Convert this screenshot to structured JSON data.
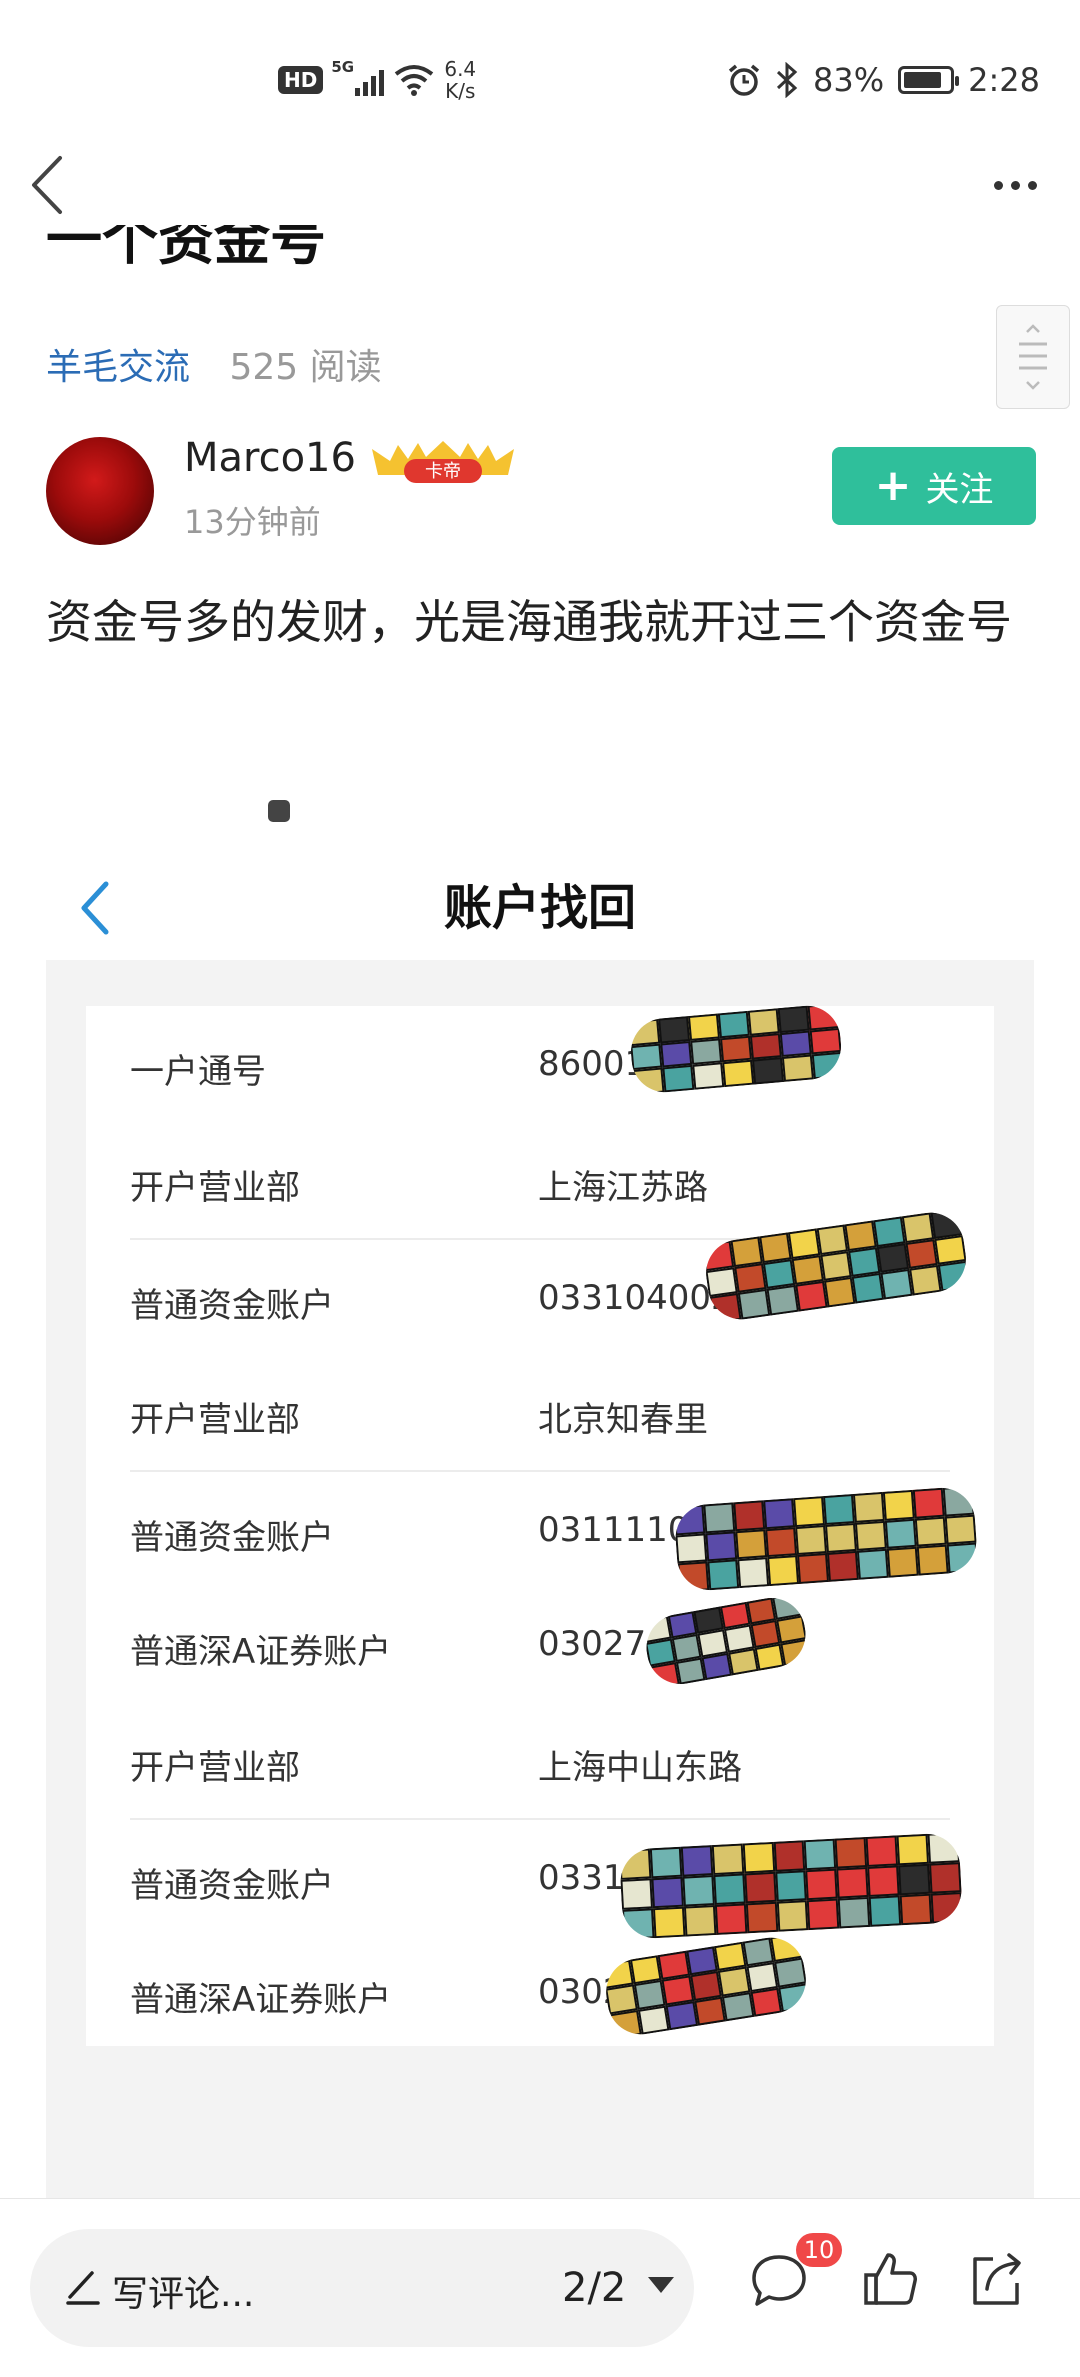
{
  "status_bar": {
    "hd": "HD",
    "net": "5G",
    "speed_value": "6.4",
    "speed_unit": "K/s",
    "battery_text": "83%",
    "battery_level": 0.83,
    "time": "2:28"
  },
  "article": {
    "title_cut": "一个资金号",
    "category": "羊毛交流",
    "reads": "525 阅读"
  },
  "author": {
    "name": "Marco16",
    "badge": "卡帝",
    "time": "13分钟前",
    "follow_label": "关注"
  },
  "post": {
    "text": "资金号多的发财，光是海通我就开过三个资金号"
  },
  "embed": {
    "title": "账户找回",
    "rows": [
      {
        "label": "一户通号",
        "value": "86001"
      },
      {
        "label": "开户营业部",
        "value": "上海江苏路"
      },
      {
        "label": "普通资金账户",
        "value": "0331040020"
      },
      {
        "label": "开户营业部",
        "value": "北京知春里"
      },
      {
        "label": "普通资金账户",
        "value": "031111000"
      },
      {
        "label": "普通深A证券账户",
        "value": "030274"
      },
      {
        "label": "开户营业部",
        "value": "上海中山东路"
      },
      {
        "label": "普通资金账户",
        "value": "03312"
      },
      {
        "label": "普通深A证券账户",
        "value": "0302"
      }
    ]
  },
  "bottom_bar": {
    "comment_placeholder": "写评论...",
    "page_indicator": "2/2",
    "comment_count": "10"
  },
  "colors": {
    "accent_green": "#2fbf9b",
    "link_blue": "#2b6cb5",
    "badge_red": "#f04848"
  },
  "icons": [
    "back-icon",
    "more-icon",
    "plus-icon",
    "pen-icon",
    "chevron-down-icon",
    "comment-icon",
    "thumbs-up-icon",
    "share-icon"
  ]
}
